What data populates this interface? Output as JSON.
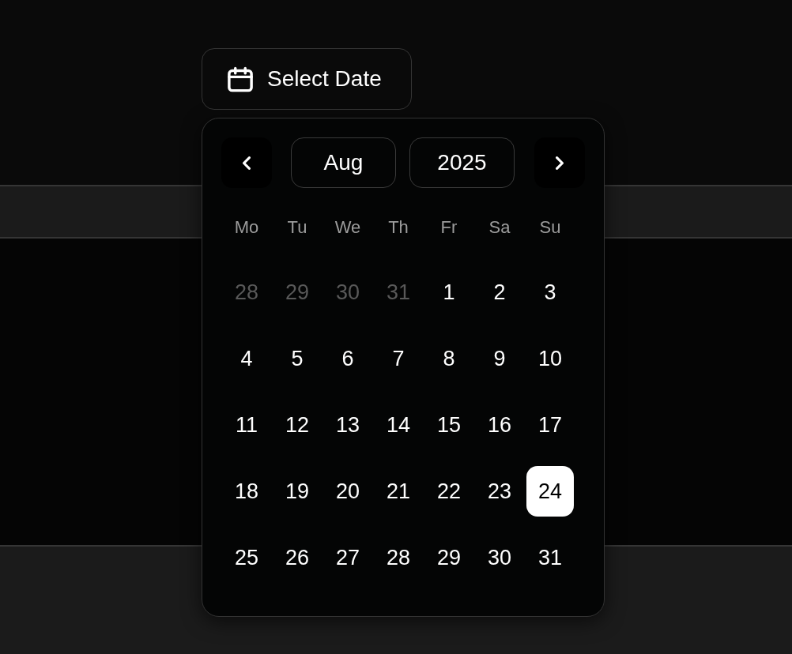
{
  "trigger": {
    "label": "Select Date"
  },
  "calendar": {
    "month": "Aug",
    "year": "2025",
    "weekdays": [
      "Mo",
      "Tu",
      "We",
      "Th",
      "Fr",
      "Sa",
      "Su"
    ],
    "weeks": [
      [
        {
          "day": "28",
          "outside_month": true,
          "selected": false
        },
        {
          "day": "29",
          "outside_month": true,
          "selected": false
        },
        {
          "day": "30",
          "outside_month": true,
          "selected": false
        },
        {
          "day": "31",
          "outside_month": true,
          "selected": false
        },
        {
          "day": "1",
          "outside_month": false,
          "selected": false
        },
        {
          "day": "2",
          "outside_month": false,
          "selected": false
        },
        {
          "day": "3",
          "outside_month": false,
          "selected": false
        }
      ],
      [
        {
          "day": "4",
          "outside_month": false,
          "selected": false
        },
        {
          "day": "5",
          "outside_month": false,
          "selected": false
        },
        {
          "day": "6",
          "outside_month": false,
          "selected": false
        },
        {
          "day": "7",
          "outside_month": false,
          "selected": false
        },
        {
          "day": "8",
          "outside_month": false,
          "selected": false
        },
        {
          "day": "9",
          "outside_month": false,
          "selected": false
        },
        {
          "day": "10",
          "outside_month": false,
          "selected": false
        }
      ],
      [
        {
          "day": "11",
          "outside_month": false,
          "selected": false
        },
        {
          "day": "12",
          "outside_month": false,
          "selected": false
        },
        {
          "day": "13",
          "outside_month": false,
          "selected": false
        },
        {
          "day": "14",
          "outside_month": false,
          "selected": false
        },
        {
          "day": "15",
          "outside_month": false,
          "selected": false
        },
        {
          "day": "16",
          "outside_month": false,
          "selected": false
        },
        {
          "day": "17",
          "outside_month": false,
          "selected": false
        }
      ],
      [
        {
          "day": "18",
          "outside_month": false,
          "selected": false
        },
        {
          "day": "19",
          "outside_month": false,
          "selected": false
        },
        {
          "day": "20",
          "outside_month": false,
          "selected": false
        },
        {
          "day": "21",
          "outside_month": false,
          "selected": false
        },
        {
          "day": "22",
          "outside_month": false,
          "selected": false
        },
        {
          "day": "23",
          "outside_month": false,
          "selected": false
        },
        {
          "day": "24",
          "outside_month": false,
          "selected": true
        }
      ],
      [
        {
          "day": "25",
          "outside_month": false,
          "selected": false
        },
        {
          "day": "26",
          "outside_month": false,
          "selected": false
        },
        {
          "day": "27",
          "outside_month": false,
          "selected": false
        },
        {
          "day": "28",
          "outside_month": false,
          "selected": false
        },
        {
          "day": "29",
          "outside_month": false,
          "selected": false
        },
        {
          "day": "30",
          "outside_month": false,
          "selected": false
        },
        {
          "day": "31",
          "outside_month": false,
          "selected": false
        }
      ]
    ]
  }
}
